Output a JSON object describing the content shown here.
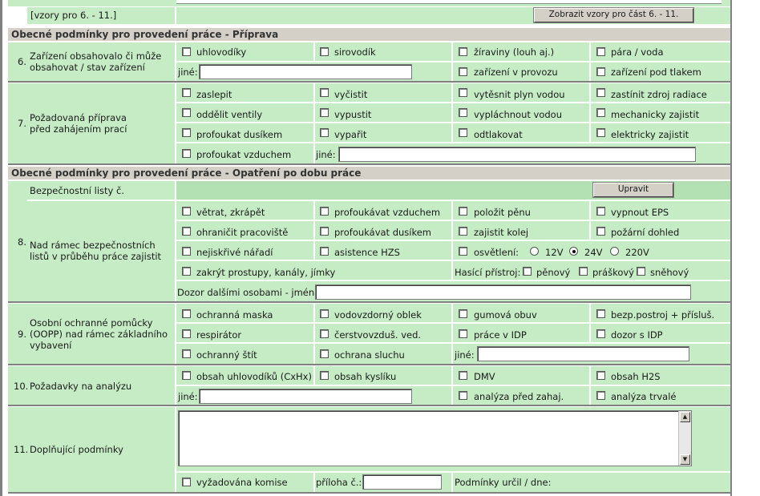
{
  "top": {
    "vzory_label": "[vzory pro 6. - 11.]",
    "vzory_button": "Zobrazit vzory pro část 6. - 11."
  },
  "section_prep": "Obecné podmínky pro provedení práce - Příprava",
  "section_during": "Obecné podmínky pro provedení práce - Opatření po dobu práce",
  "r6": {
    "num": "6.",
    "title_l1": "Zařízení obsahovalo či může",
    "title_l2": "obsahovat / stav zařízení",
    "items": [
      "uhlovodíky",
      "sirovodík",
      "žíraviny (louh aj.)",
      "pára / voda",
      "zařízení v provozu",
      "zařízení pod tlakem"
    ],
    "other_label": "jiné:"
  },
  "r7": {
    "num": "7.",
    "title_l1": "Požadovaná příprava",
    "title_l2": "před zahájením prací",
    "items": [
      "zaslepit",
      "vyčistit",
      "vytěsnit plyn vodou",
      "zastínit zdroj radiace",
      "oddělit ventily",
      "vypustit",
      "vypláchnout vodou",
      "mechanicky zajistit",
      "profoukat dusíkem",
      "vypařit",
      "odtlakovat",
      "elektricky zajistit",
      "profoukat vzduchem"
    ],
    "other_label": "jiné:"
  },
  "r8": {
    "num": "8.",
    "bl_label": "Bezpečnostní listy č.",
    "edit_button": "Upravit",
    "title_l1": "Nad rámec bezpečnostních",
    "title_l2": "listů v průběhu práce zajistit",
    "items": [
      "větrat, zkrápět",
      "profoukávat vzduchem",
      "položit pěnu",
      "vypnout EPS",
      "ohraničit pracoviště",
      "profoukávat dusíkem",
      "zajistit kolej",
      "požární dohled",
      "nejiskřivé nářadí",
      "asistence HZS",
      "osvětlení:",
      "zakrýt prostupy, kanály, jímky"
    ],
    "voltages": [
      "12V",
      "24V",
      "220V"
    ],
    "extinguisher_label": "Hasící přístroj:",
    "extinguishers": [
      "pěnový",
      "práškový",
      "sněhový"
    ],
    "supervision_label": "Dozor dalšími osobami - jména:"
  },
  "r9": {
    "num": "9.",
    "title_l1": "Osobní ochranné pomůcky",
    "title_l2": "(OOPP) nad rámec základního",
    "title_l3": "vybavení",
    "items": [
      "ochranná maska",
      "vodovzdorný oblek",
      "gumová obuv",
      "bezp.postroj + přísluš.",
      "respirátor",
      "čerstvovzduš. ved.",
      "práce v IDP",
      "dozor s IDP",
      "ochranný štít",
      "ochrana sluchu"
    ],
    "other_label": "jiné:"
  },
  "r10": {
    "num": "10.",
    "title": "Požadavky na analýzu",
    "items": [
      "obsah uhlovodíků (CxHx)",
      "obsah kyslíku",
      "DMV",
      "obsah H2S",
      "analýza před zahaj.",
      "analýza trvalé"
    ],
    "other_label": "jiné:"
  },
  "r11": {
    "num": "11.",
    "title": "Doplňující podmínky",
    "committee": "vyžadována komise",
    "attachment_label": "příloha č.:",
    "conditions_label": "Podmínky určil / dne:"
  }
}
